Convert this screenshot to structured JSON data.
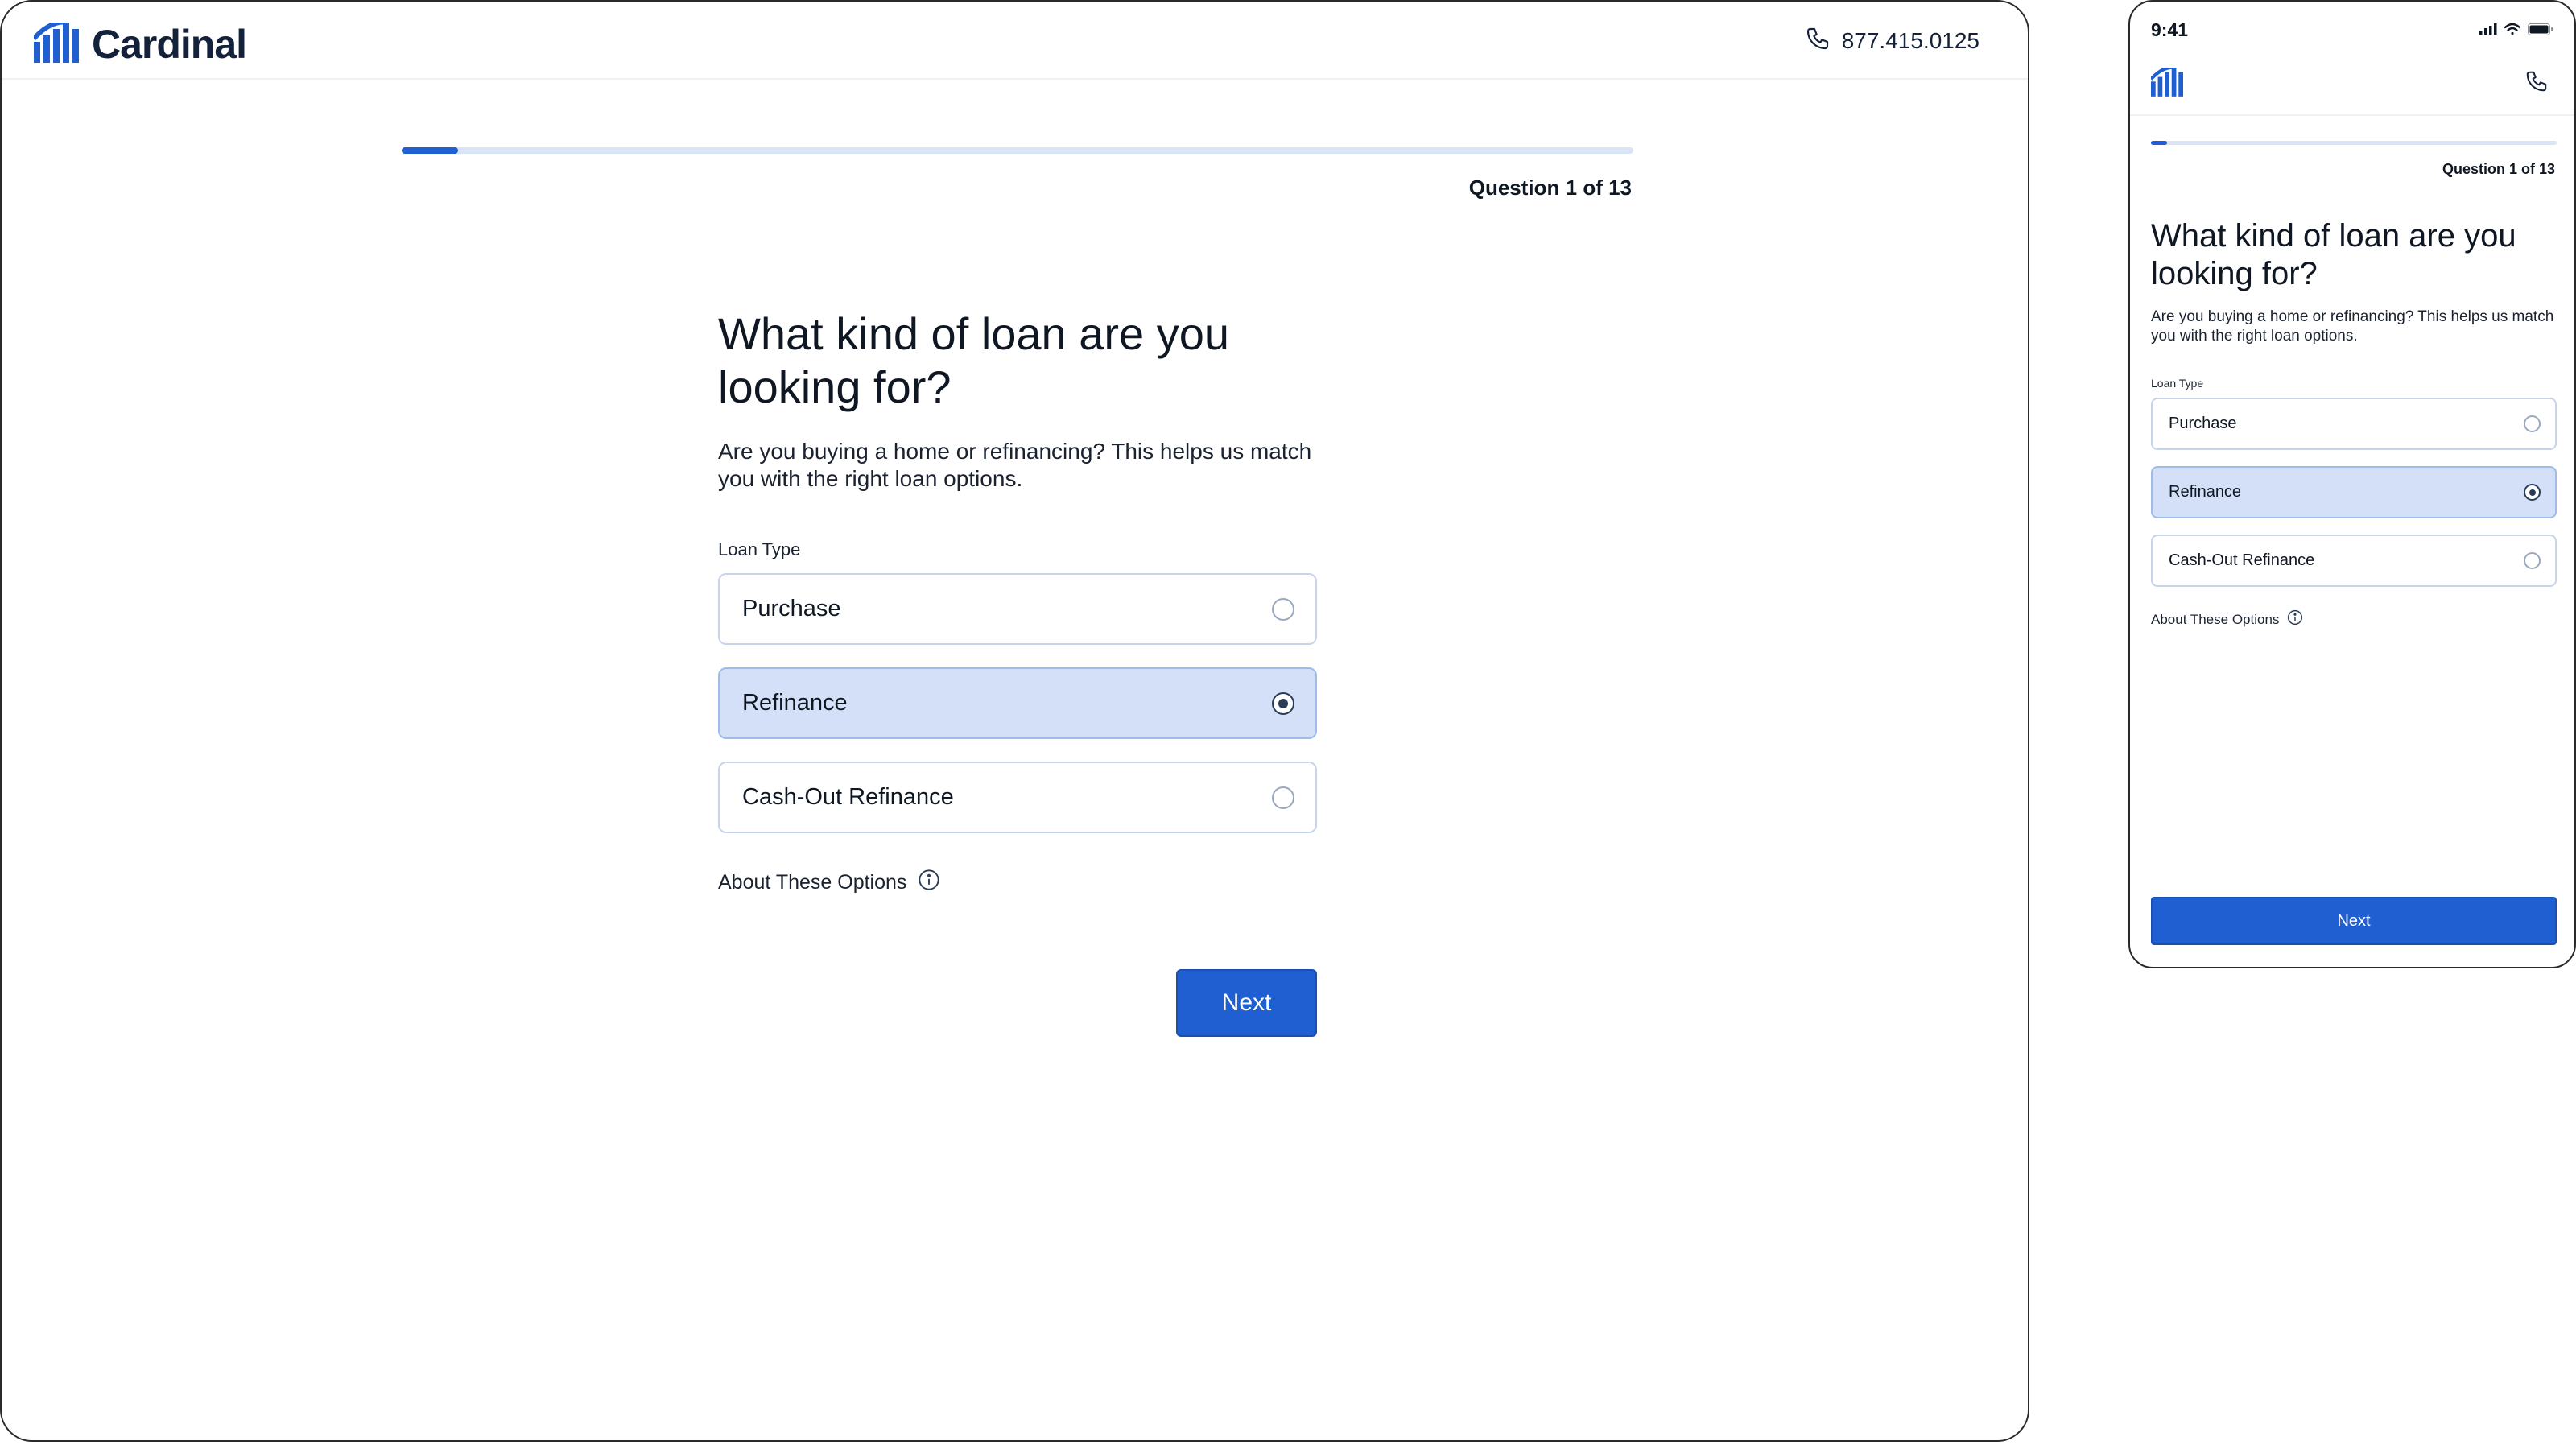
{
  "colors": {
    "accent": "#1f5fd1",
    "selected_option_bg": "#d3e0f7",
    "progress_track": "#d9e4f4"
  },
  "desktop": {
    "brand_name": "Cardinal",
    "logo_icon": "cardinal-logo-icon",
    "phone_icon": "phone-icon",
    "phone_number": "877.415.0125",
    "progress": {
      "current": 1,
      "total": 13,
      "fraction": 0.077
    },
    "question_counter": "Question 1 of 13",
    "title": "What kind of loan are you looking for?",
    "subtitle": "Are you buying a home or refinancing? This helps us match you with the right loan options.",
    "field_label": "Loan Type",
    "options": [
      {
        "label": "Purchase",
        "selected": false
      },
      {
        "label": "Refinance",
        "selected": true
      },
      {
        "label": "Cash-Out Refinance",
        "selected": false
      }
    ],
    "about_link": "About These Options",
    "info_icon": "info-icon",
    "next_button": "Next"
  },
  "mobile": {
    "status_time": "9:41",
    "status_icons": [
      "signal-icon",
      "wifi-icon",
      "battery-icon"
    ],
    "logo_icon": "cardinal-logo-icon",
    "phone_icon": "phone-icon",
    "progress": {
      "current": 1,
      "total": 13,
      "fraction": 0.04
    },
    "question_counter": "Question 1 of 13",
    "title": "What kind of loan are you looking for?",
    "subtitle": "Are you buying a home or refinancing? This helps us match you with the right loan options.",
    "field_label": "Loan Type",
    "options": [
      {
        "label": "Purchase",
        "selected": false
      },
      {
        "label": "Refinance",
        "selected": true
      },
      {
        "label": "Cash-Out Refinance",
        "selected": false
      }
    ],
    "about_link": "About These Options",
    "next_button": "Next"
  }
}
